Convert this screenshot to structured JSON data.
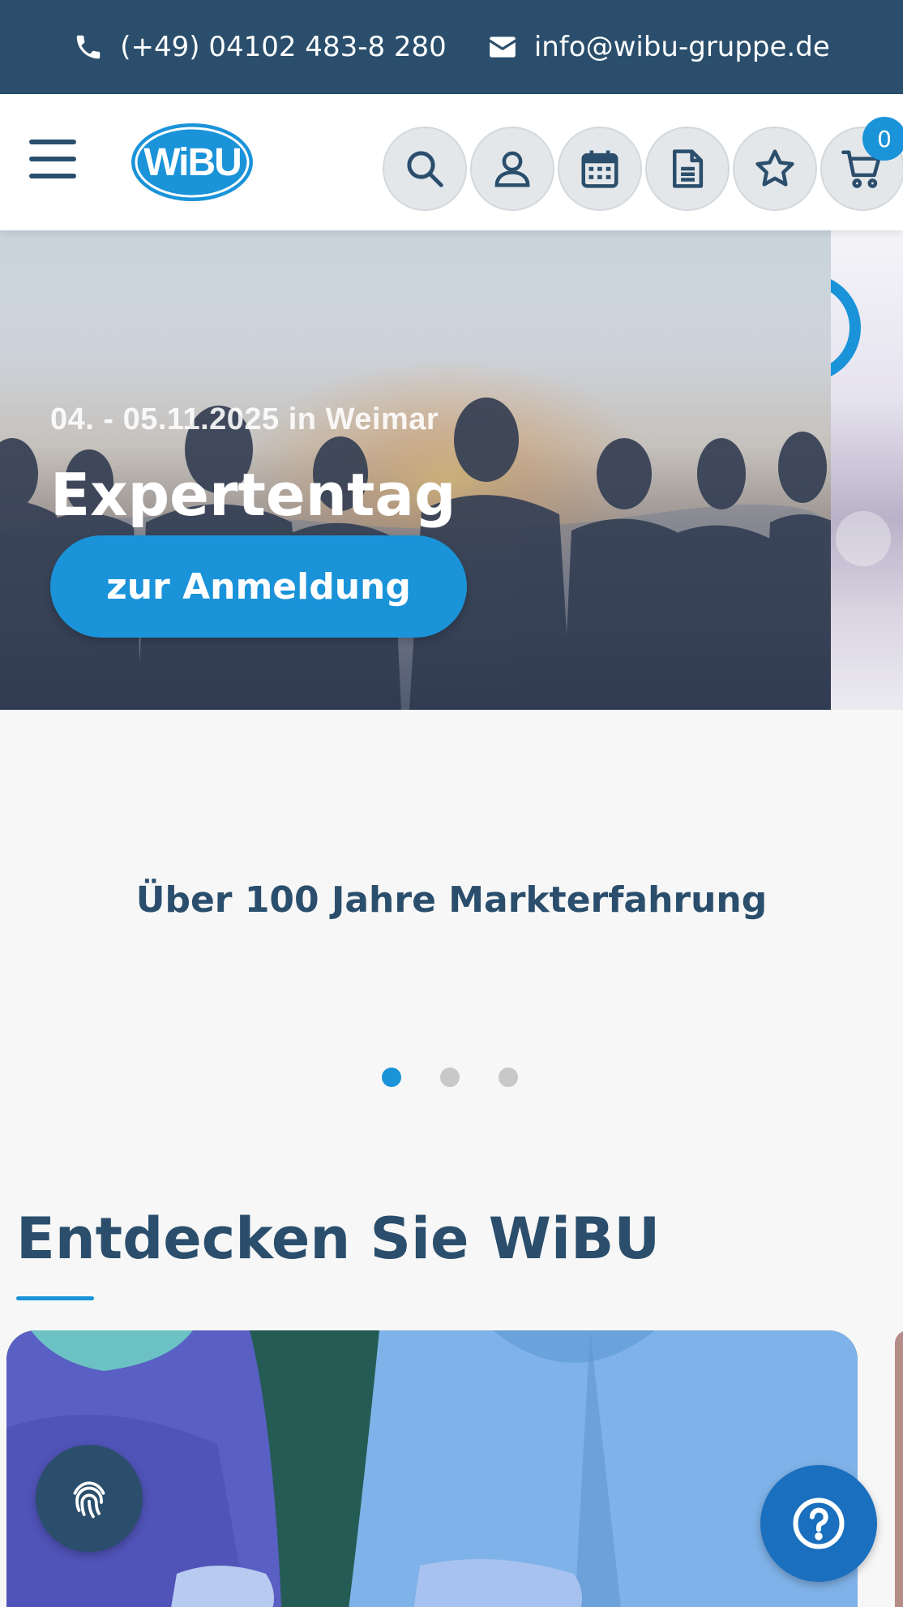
{
  "topbar": {
    "phone": "(+49) 04102 483-8 280",
    "email": "info@wibu-gruppe.de",
    "phone_icon": "phone-icon",
    "email_icon": "envelope-icon"
  },
  "header": {
    "logo_text": "WiBU",
    "menu_icon": "hamburger-menu-icon",
    "icons": [
      "search-icon",
      "user-icon",
      "calendar-icon",
      "document-icon",
      "star-icon",
      "cart-icon"
    ],
    "cart_count": "0"
  },
  "hero": {
    "subtitle": "04. - 05.11.2025 in Weimar",
    "title": "Expertentag",
    "cta_label": "zur Anmeldung"
  },
  "tagline": "Über 100 Jahre Markterfahrung",
  "slider": {
    "slide_count": 3,
    "active_index": 0
  },
  "discover": {
    "title": "Entdecken Sie WiBU"
  },
  "floating": {
    "privacy_icon": "fingerprint-icon",
    "help_icon": "question-mark-icon"
  },
  "colors": {
    "navy": "#2a4e6c",
    "accent_blue": "#1a93d9",
    "help_blue": "#1a6fbf",
    "page_bg": "#f7f7f7"
  }
}
